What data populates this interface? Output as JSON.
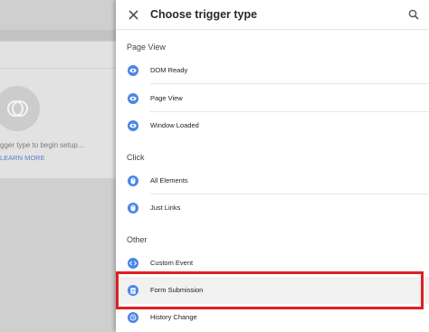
{
  "background": {
    "hint_text": "gger type to begin setup...",
    "learn_more": "LEARN MORE"
  },
  "panel": {
    "title": "Choose trigger type",
    "sections": [
      {
        "label": "Page View",
        "items": [
          {
            "label": "DOM Ready",
            "icon": "eye-icon"
          },
          {
            "label": "Page View",
            "icon": "eye-icon"
          },
          {
            "label": "Window Loaded",
            "icon": "eye-icon"
          }
        ]
      },
      {
        "label": "Click",
        "items": [
          {
            "label": "All Elements",
            "icon": "mouse-icon"
          },
          {
            "label": "Just Links",
            "icon": "mouse-icon"
          }
        ]
      },
      {
        "label": "Other",
        "items": [
          {
            "label": "Custom Event",
            "icon": "code-icon"
          },
          {
            "label": "Form Submission",
            "icon": "form-icon"
          },
          {
            "label": "History Change",
            "icon": "history-icon"
          }
        ]
      }
    ]
  },
  "colors": {
    "accent": "#4a86e8",
    "highlight_border": "#e02020"
  }
}
